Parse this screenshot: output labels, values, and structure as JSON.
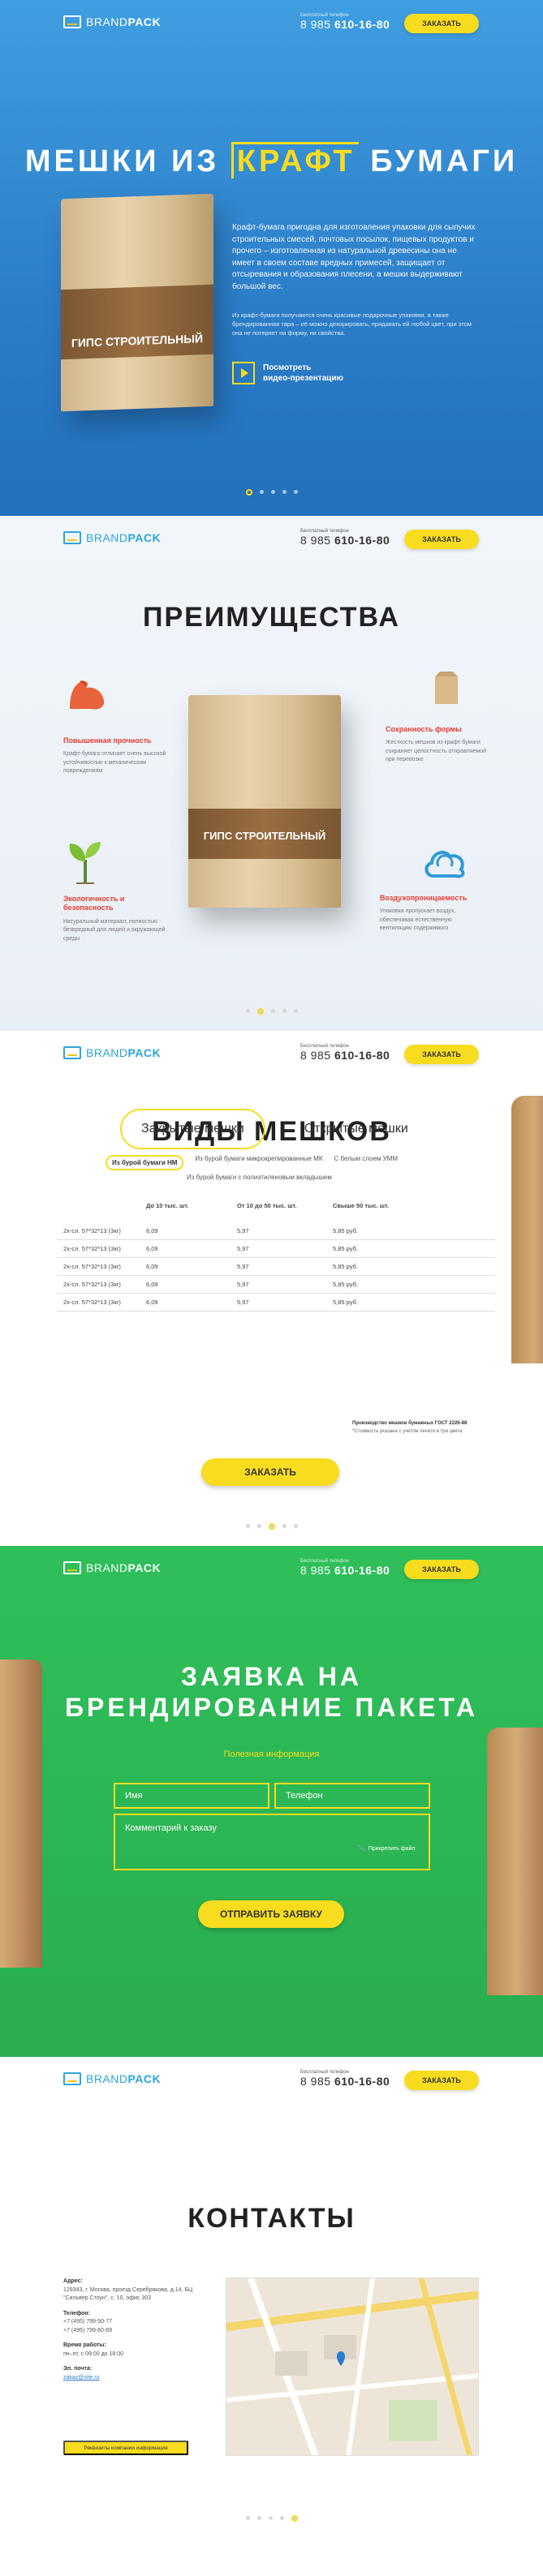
{
  "header": {
    "logo_light": "BRAND",
    "logo_bold": "PACK",
    "phone_caption": "Бесплатный телефон",
    "phone_prefix": "8 985",
    "phone_number": "610-16-80",
    "order_label": "ЗАКАЗАТЬ"
  },
  "hero": {
    "title_before": "МЕШКИ ИЗ ",
    "title_highlight": "КРАФТ",
    "title_after": " БУМАГИ",
    "bag_label": "ГИПС СТРОИТЕЛЬНЫЙ",
    "text_1": "Крафт-бумага пригодна для изготовления упаковки для сыпучих строительных смесей, почтовых посылок, пищевых продуктов и прочего – изготовленная из натуральной древесины она не имеет в своем составе вредных примесей, защищает от отсыревания и образования плесени, а мешки выдерживают большой вес.",
    "text_2": "Из крафт-бумаги получаются очень красивые подарочные упаковки, а также брендированная тара – её можно декорировать, придавать ей любой цвет, при этом она не потеряет ни форму, ни свойства.",
    "video_label": "Посмотреть\nвидео-презентацию"
  },
  "advantages": {
    "title": "ПРЕИМУЩЕСТВА",
    "bag_label": "ГИПС СТРОИТЕЛЬНЫЙ",
    "items": [
      {
        "title": "Повышенная прочность",
        "text": "Крафт-бумага отличает очень высокой устойчивостью к механическим повреждениям"
      },
      {
        "title": "Сохранность формы",
        "text": "Жесткость мешков из крафт-бумаги сохраняет целостность отправляемой при перевозке"
      },
      {
        "title": "Экологичность и безопасность",
        "text": "Натуральный материал, полностью безвредный для людей и окружающей среды"
      },
      {
        "title": "Воздухопроницаемость",
        "text": "Упаковка пропускает воздух, обеспечивая естественную вентиляцию содержимого"
      }
    ]
  },
  "types": {
    "title": "ВИДЫ МЕШКОВ",
    "tabs": [
      "Закрытые мешки",
      "Открытые мешки"
    ],
    "subtabs": [
      "Из бурой бумаги НМ",
      "Из бурой бумаги микрокрепированные МК",
      "С белым слоем УММ",
      "Из бурой бумаги с полиэтиленовым вкладышем"
    ],
    "columns": [
      "",
      "До 10 тыс. шт.",
      "От 10 до 50 тыс. шт.",
      "Свыше 50 тыс. шт."
    ],
    "rows": [
      [
        "2х-сл. 57*32*13 (3кг)",
        "6,09",
        "5,97",
        "5,85 руб."
      ],
      [
        "2х-сл. 57*32*13 (3кг)",
        "6,09",
        "5,97",
        "5,85 руб."
      ],
      [
        "2х-сл. 57*32*13 (3кг)",
        "6,09",
        "5,97",
        "5,85 руб."
      ],
      [
        "2х-сл. 57*32*13 (3кг)",
        "6,09",
        "5,97",
        "5,85 руб."
      ],
      [
        "2х-сл. 57*32*13 (3кг)",
        "6,09",
        "5,97",
        "5,85 руб."
      ]
    ],
    "gost": "Производство мешков бумажных ГОСТ 2226-88",
    "note": "*Стоимость указана с учетом печати в три цвета",
    "order_label": "ЗАКАЗАТЬ"
  },
  "request": {
    "title_line1": "ЗАЯВКА НА",
    "title_line2": "БРЕНДИРОВАНИЕ ПАКЕТА",
    "useful": "Полезная информация",
    "name_placeholder": "Имя",
    "phone_placeholder": "Телефон",
    "comment_placeholder": "Комментарий к заказу",
    "attach_label": "Прикрепить файл",
    "submit_label": "ОТПРАВИТЬ ЗАЯВКУ"
  },
  "contacts": {
    "title": "КОНТАКТЫ",
    "address_label": "Адрес:",
    "address": "129343, г. Москва, проезд Серебрякова, д.14, БЦ \"Сильвер Стоун\", с. 10, офис 303",
    "phone_label": "Телефон:",
    "phones": [
      "+7 (495) 799-50-77",
      "+7 (495) 799-60-69"
    ],
    "hours_label": "Время работы:",
    "hours": "пн–пт, с 09:00 до 18:00",
    "email_label": "Эл. почта:",
    "email": "zakaz@site.ru",
    "req_button": "Реквизиты компании информация"
  }
}
